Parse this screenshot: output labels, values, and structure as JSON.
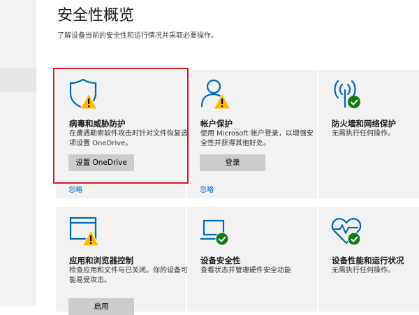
{
  "page": {
    "title": "安全性概览",
    "subtitle": "了解设备当前的安全性和运行情况并采取必要操作。"
  },
  "tiles": [
    {
      "id": "virus",
      "icon": "shield-warning-icon",
      "title": "病毒和威胁防护",
      "description": "在遭遇勒索软件攻击时针对文件恢复选项设置 OneDrive。",
      "button": "设置 OneDrive",
      "link": "忽略"
    },
    {
      "id": "account",
      "icon": "person-warning-icon",
      "title": "帐户保护",
      "description": "使用 Microsoft 帐户登录，以增强安全性并获得其他好处。",
      "button": "登录",
      "link": "忽略"
    },
    {
      "id": "firewall",
      "icon": "antenna-check-icon",
      "title": "防火墙和网络保护",
      "description": "无需执行任何操作。"
    },
    {
      "id": "app-browser",
      "icon": "browser-window-warning-icon",
      "title": "应用和浏览器控制",
      "description": "检查应用和文件与已关闭。你的设备可能易受攻击。",
      "button": "启用"
    },
    {
      "id": "device-security",
      "icon": "laptop-check-icon",
      "title": "设备安全性",
      "description": "查看状态并管理硬件安全功能"
    },
    {
      "id": "device-performance",
      "icon": "heart-pulse-check-icon",
      "title": "设备性能和运行状况",
      "description": "无需执行任何操作。"
    }
  ],
  "colors": {
    "accent_blue": "#0067b8",
    "warning_yellow": "#ffb900",
    "ok_green": "#107c10",
    "highlight_red": "#e0141e",
    "tile_background": "#f2f2f2",
    "button_gray": "#cccccc"
  }
}
